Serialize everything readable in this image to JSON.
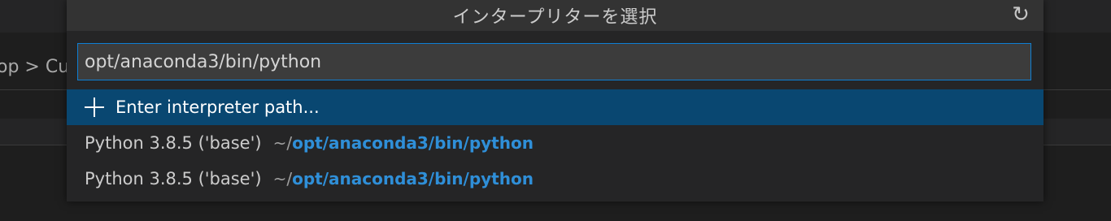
{
  "background": {
    "breadcrumb_text": "op > Cu"
  },
  "quick_pick": {
    "title": "インタープリターを選択",
    "refresh_icon": "refresh-icon",
    "input": {
      "value": "opt/anaconda3/bin/python",
      "placeholder": ""
    },
    "items": [
      {
        "icon": "plus-icon",
        "label": "Enter interpreter path...",
        "selected": true
      },
      {
        "label": "Python 3.8.5 ('base')",
        "desc_prefix": "~/",
        "desc_highlight": "opt/anaconda3/bin/python"
      },
      {
        "label": "Python 3.8.5 ('base')",
        "desc_prefix": "~/",
        "desc_highlight": "opt/anaconda3/bin/python"
      }
    ]
  },
  "colors": {
    "accent": "#0e7fd4",
    "selection": "#094771",
    "highlight": "#2f8fd8"
  }
}
